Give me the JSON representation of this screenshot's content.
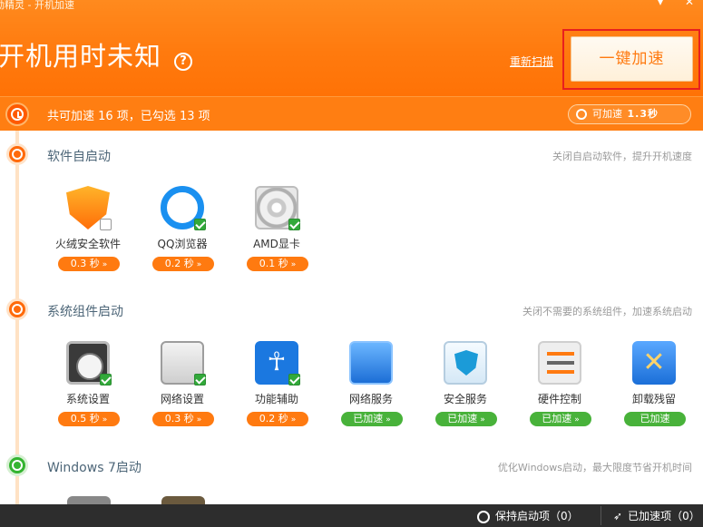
{
  "window": {
    "title": "励精灵 - 开机加速",
    "menu_icon": "dropdown-menu-icon",
    "close_icon": "close-icon"
  },
  "header": {
    "boot_time_title": "开机用时未知",
    "help_symbol": "?",
    "rescan_label": "重新扫描",
    "one_click_label": "一键加速"
  },
  "summary": {
    "text": "共可加速 16 项，已勾选 13 项",
    "pill_label": "可加速",
    "pill_value": "1.3秒"
  },
  "sections": [
    {
      "title": "软件自启动",
      "desc": "关闭自启动软件，提升开机速度",
      "items": [
        {
          "label": "火绒安全软件",
          "time": "0.3 秒",
          "checked": false,
          "icon": "huorong-shield-icon"
        },
        {
          "label": "QQ浏览器",
          "time": "0.2 秒",
          "checked": true,
          "icon": "qq-browser-icon"
        },
        {
          "label": "AMD显卡",
          "time": "0.1 秒",
          "checked": true,
          "icon": "amd-disc-icon"
        }
      ]
    },
    {
      "title": "系统组件启动",
      "desc": "关闭不需要的系统组件，加速系统启动",
      "items": [
        {
          "label": "系统设置",
          "time": "0.5 秒",
          "checked": true,
          "icon": "gauge-icon"
        },
        {
          "label": "网络设置",
          "time": "0.3 秒",
          "checked": true,
          "icon": "network-settings-icon"
        },
        {
          "label": "功能辅助",
          "time": "0.2 秒",
          "checked": true,
          "icon": "accessibility-icon"
        },
        {
          "label": "网络服务",
          "time": "已加速",
          "checked": false,
          "icon": "network-service-icon"
        },
        {
          "label": "安全服务",
          "time": "已加速",
          "checked": false,
          "icon": "security-service-icon"
        },
        {
          "label": "硬件控制",
          "time": "已加速",
          "checked": false,
          "icon": "hardware-control-icon"
        },
        {
          "label": "卸载残留",
          "time": "已加速",
          "checked": false,
          "icon": "tools-icon"
        }
      ]
    },
    {
      "title": "Windows 7启动",
      "desc": "优化Windows启动，最大限度节省开机时间"
    }
  ],
  "bottom": {
    "keep_label": "保持启动项（0）",
    "accelerated_label": "已加速项（0）"
  },
  "colors": {
    "brand_orange": "#ff7a10",
    "accelerated_green": "#48b23a",
    "highlight_red": "#e8201e",
    "bottom_bar": "#2d2d2d"
  }
}
